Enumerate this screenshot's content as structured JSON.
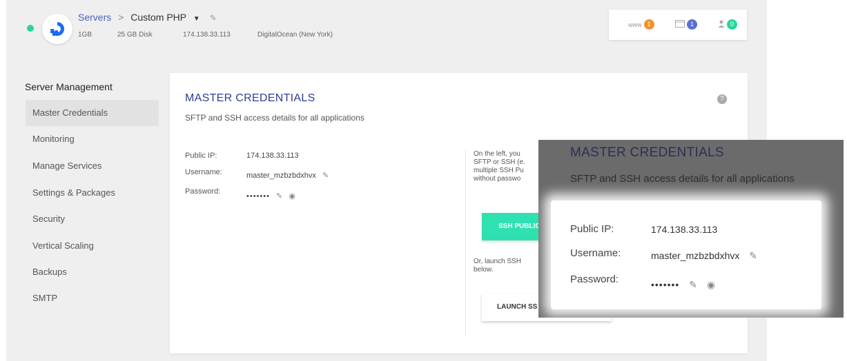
{
  "header": {
    "breadcrumb": {
      "root": "Servers",
      "separator": ">",
      "current": "Custom PHP"
    },
    "server_specs": {
      "memory": "1GB",
      "disk": "25 GB Disk",
      "ip": "174.138.33.113",
      "provider": "DigitalOcean (New York)"
    },
    "notifications": [
      {
        "icon": "www-icon",
        "label": "www",
        "count": "1",
        "color": "#f0932b"
      },
      {
        "icon": "window-icon",
        "label": "",
        "count": "1",
        "color": "#5b6fd0"
      },
      {
        "icon": "users-icon",
        "label": "",
        "count": "0",
        "color": "#2bd49b"
      }
    ]
  },
  "sidebar": {
    "title": "Server Management",
    "items": [
      {
        "label": "Master Credentials",
        "active": true
      },
      {
        "label": "Monitoring"
      },
      {
        "label": "Manage Services"
      },
      {
        "label": "Settings & Packages"
      },
      {
        "label": "Security"
      },
      {
        "label": "Vertical Scaling"
      },
      {
        "label": "Backups"
      },
      {
        "label": "SMTP"
      }
    ]
  },
  "card": {
    "title": "MASTER CREDENTIALS",
    "subtitle": "SFTP and SSH access details for all applications",
    "help": "?",
    "credentials": {
      "public_ip_label": "Public IP:",
      "public_ip": "174.138.33.113",
      "username_label": "Username:",
      "username": "master_mzbzbdxhvx",
      "password_label": "Password:",
      "password_mask": "•••••••"
    },
    "right": {
      "intro_lines": [
        "On the left, you",
        "SFTP or SSH (e.",
        "multiple SSH Pu",
        "without passwo"
      ],
      "ssh_keys_button": "SSH PUBLIC",
      "launch_lines": [
        "Or, launch SSH",
        "below."
      ],
      "launch_button": "LAUNCH SS"
    }
  },
  "zoom": {
    "title": "MASTER CREDENTIALS",
    "subtitle": "SFTP and SSH access details for all applications"
  }
}
